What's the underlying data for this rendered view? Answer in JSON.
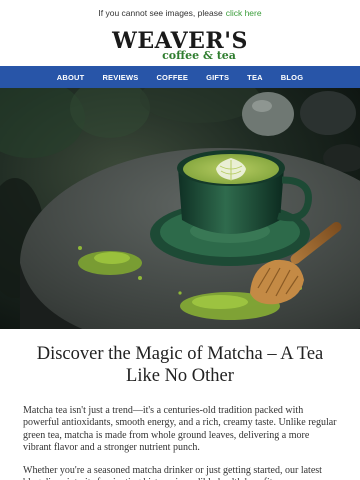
{
  "preheader": {
    "text": "If you cannot see images, please",
    "link": "click here"
  },
  "logo": {
    "main": "WEAVER'S",
    "sub": "coffee & tea"
  },
  "nav": {
    "items": [
      "ABOUT",
      "REVIEWS",
      "COFFEE",
      "GIFTS",
      "TEA",
      "BLOG"
    ]
  },
  "colors": {
    "nav_bg": "#2855a8",
    "link": "#3a9d3a",
    "brand_green": "#2f7d2f"
  },
  "hero_image": {
    "icon": "matcha-latte-photo"
  },
  "article": {
    "headline": "Discover the Magic of Matcha – A Tea Like No Other",
    "paragraph_1": "Matcha tea isn't just a trend—it's a centuries-old tradition packed with powerful antioxidants, smooth energy, and a rich, creamy taste. Unlike regular green tea, matcha is made from whole ground leaves, delivering a more vibrant flavor and a stronger nutrient punch.",
    "paragraph_2": "Whether you're a seasoned matcha drinker or just getting started, our latest blog dives into its fascinating history, incredible health benefits,"
  }
}
